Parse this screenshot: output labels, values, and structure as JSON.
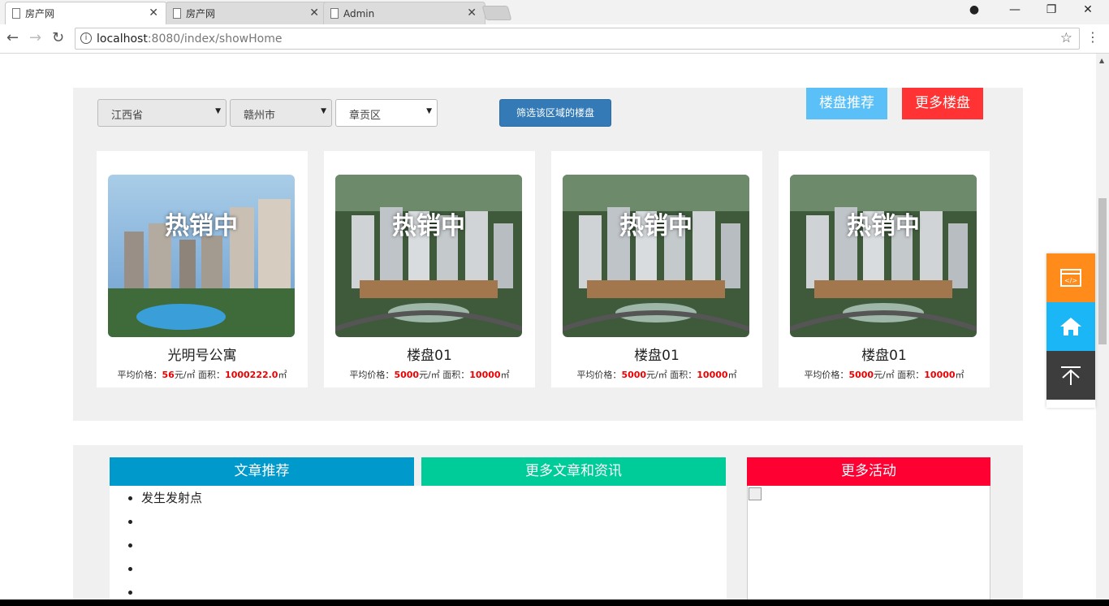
{
  "browser": {
    "tabs": [
      {
        "title": "房产网"
      },
      {
        "title": "房产网"
      },
      {
        "title": "Admin"
      }
    ],
    "url_host": "localhost",
    "url_path": ":8080/index/showHome"
  },
  "filter": {
    "province": "江西省",
    "city": "赣州市",
    "district": "章贡区",
    "button": "筛选该区域的楼盘"
  },
  "buttons": {
    "recommend": "楼盘推荐",
    "more": "更多楼盘",
    "recommend_color": "#5bc0f8",
    "more_color": "#ff3333"
  },
  "listings": [
    {
      "badge": "热销中",
      "name": "光明号公寓",
      "price_label": "平均价格：",
      "price": "56",
      "price_unit": "元/㎡",
      "area_label": " 面积：",
      "area": "1000222.0",
      "area_unit": "㎡"
    },
    {
      "badge": "热销中",
      "name": "楼盘01",
      "price_label": "平均价格：",
      "price": "5000",
      "price_unit": "元/㎡",
      "area_label": " 面积：",
      "area": "10000",
      "area_unit": "㎡"
    },
    {
      "badge": "热销中",
      "name": "楼盘01",
      "price_label": "平均价格：",
      "price": "5000",
      "price_unit": "元/㎡",
      "area_label": " 面积：",
      "area": "10000",
      "area_unit": "㎡"
    },
    {
      "badge": "热销中",
      "name": "楼盘01",
      "price_label": "平均价格：",
      "price": "5000",
      "price_unit": "元/㎡",
      "area_label": " 面积：",
      "area": "10000",
      "area_unit": "㎡"
    }
  ],
  "articles": {
    "header": "文章推荐",
    "more": "更多文章和资讯",
    "items": [
      "发生发射点",
      "",
      "",
      "",
      ""
    ]
  },
  "activities": {
    "header": "更多活动"
  },
  "colors": {
    "article_header": "#0099cc",
    "more_articles": "#00cc99",
    "activities_header": "#ff0033"
  },
  "side_icons": [
    "code-icon",
    "home-icon",
    "back-to-top-icon"
  ]
}
